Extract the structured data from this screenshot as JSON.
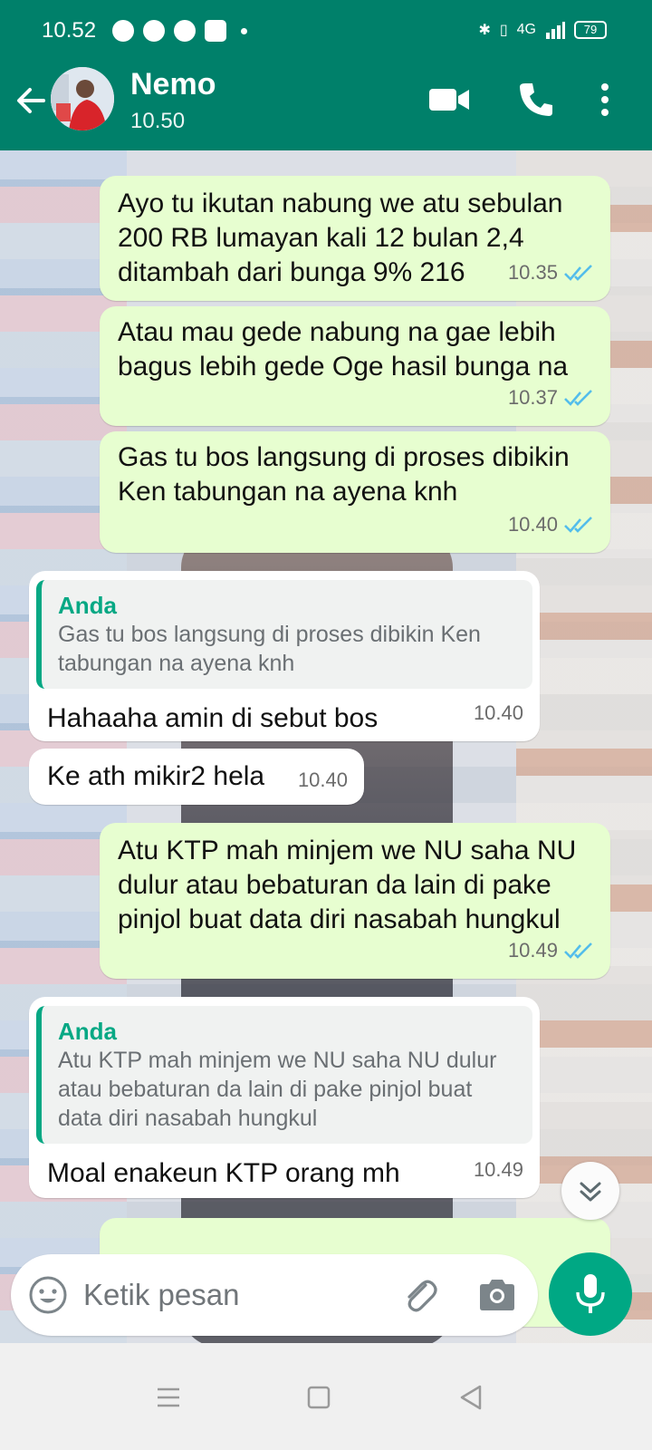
{
  "status_bar": {
    "time": "10.52",
    "network": "4G",
    "battery": "79"
  },
  "header": {
    "contact_name": "Nemo",
    "last_seen": "10.50",
    "icons": [
      "back-arrow-icon",
      "video-call-icon",
      "voice-call-icon",
      "more-options-icon"
    ]
  },
  "messages": [
    {
      "direction": "out",
      "text": "Ayo tu ikutan nabung we atu sebulan 200 RB lumayan kali 12 bulan 2,4 ditambah dari bunga 9% 216",
      "time": "10.35",
      "read": true
    },
    {
      "direction": "out",
      "text": "Atau mau gede nabung na gae lebih bagus lebih gede Oge hasil bunga na",
      "time": "10.37",
      "read": true
    },
    {
      "direction": "out",
      "text": "Gas tu bos langsung di proses dibikin Ken tabungan na ayena knh",
      "time": "10.40",
      "read": true
    },
    {
      "direction": "in",
      "quote_author": "Anda",
      "quote_text": "Gas tu bos langsung di proses dibikin Ken tabungan na ayena knh",
      "text": "Hahaaha amin di sebut bos",
      "time": "10.40"
    },
    {
      "direction": "in",
      "text": "Ke ath mikir2 hela",
      "time": "10.40"
    },
    {
      "direction": "out",
      "text": "Atu KTP mah minjem we NU saha NU dulur atau bebaturan da lain di pake pinjol buat data diri nasabah hungkul",
      "time": "10.49",
      "read": true
    },
    {
      "direction": "in",
      "quote_author": "Anda",
      "quote_text": "Atu KTP mah minjem we NU saha NU dulur atau bebaturan da lain di pake pinjol buat data diri nasabah hungkul",
      "text": "Moal enakeun KTP orang mh",
      "time": "10.49"
    }
  ],
  "composer": {
    "placeholder": "Ketik pesan"
  },
  "colors": {
    "header": "#00806a",
    "outgoing_bubble": "#e7fed0",
    "incoming_bubble": "#ffffff",
    "accent": "#00a884",
    "read_ticks": "#53bdeb"
  }
}
